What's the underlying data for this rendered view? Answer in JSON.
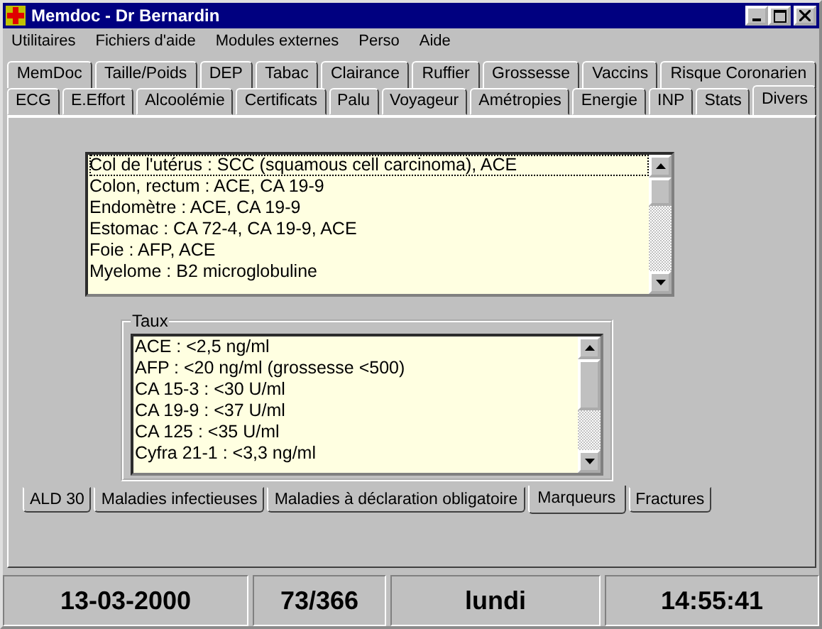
{
  "window": {
    "title": "Memdoc - Dr Bernardin"
  },
  "menu": [
    "Utilitaires",
    "Fichiers d'aide",
    "Modules externes",
    "Perso",
    "Aide"
  ],
  "tab_rows": [
    [
      {
        "label": "MemDoc",
        "selected": false
      },
      {
        "label": "Taille/Poids",
        "selected": false
      },
      {
        "label": "DEP",
        "selected": false
      },
      {
        "label": "Tabac",
        "selected": false
      },
      {
        "label": "Clairance",
        "selected": false
      },
      {
        "label": "Ruffier",
        "selected": false
      },
      {
        "label": "Grossesse",
        "selected": false
      },
      {
        "label": "Vaccins",
        "selected": false
      },
      {
        "label": "Risque Coronarien",
        "selected": false
      }
    ],
    [
      {
        "label": "ECG",
        "selected": false
      },
      {
        "label": "E.Effort",
        "selected": false
      },
      {
        "label": "Alcoolémie",
        "selected": false
      },
      {
        "label": "Certificats",
        "selected": false
      },
      {
        "label": "Palu",
        "selected": false
      },
      {
        "label": "Voyageur",
        "selected": false
      },
      {
        "label": "Amétropies",
        "selected": false
      },
      {
        "label": "Energie",
        "selected": false
      },
      {
        "label": "INP",
        "selected": false
      },
      {
        "label": "Stats",
        "selected": false
      },
      {
        "label": "Divers",
        "selected": true
      }
    ]
  ],
  "markers_list": [
    {
      "text": "Col de l'utérus : SCC (squamous cell carcinoma), ACE",
      "focused": true
    },
    {
      "text": "Colon, rectum : ACE, CA 19-9",
      "focused": false
    },
    {
      "text": "Endomètre : ACE, CA 19-9",
      "focused": false
    },
    {
      "text": "Estomac : CA 72-4, CA 19-9, ACE",
      "focused": false
    },
    {
      "text": "Foie : AFP, ACE",
      "focused": false
    },
    {
      "text": "Myelome : B2 microglobuline",
      "focused": false
    }
  ],
  "rates_group": {
    "title": "Taux",
    "items": [
      "ACE : <2,5 ng/ml",
      "AFP : <20 ng/ml (grossesse <500)",
      "CA 15-3 : <30 U/ml",
      "CA 19-9 : <37 U/ml",
      "CA 125 : <35 U/ml",
      "Cyfra 21-1 : <3,3 ng/ml"
    ]
  },
  "sub_tabs": [
    {
      "label": "ALD 30",
      "selected": false
    },
    {
      "label": "Maladies infectieuses",
      "selected": false
    },
    {
      "label": "Maladies à déclaration obligatoire",
      "selected": false
    },
    {
      "label": "Marqueurs",
      "selected": true
    },
    {
      "label": "Fractures",
      "selected": false
    }
  ],
  "status_bar": [
    "13-03-2000",
    "73/366",
    "lundi",
    "14:55:41"
  ]
}
